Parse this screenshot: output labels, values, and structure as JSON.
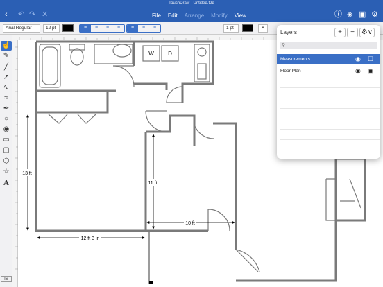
{
  "window": {
    "title": "TouchDraw - Untitled.t2d"
  },
  "menu": {
    "file": "File",
    "edit": "Edit",
    "arrange": "Arrange",
    "modify": "Modify",
    "view": "View"
  },
  "titlebar_icons": {
    "back": "chevron-left-icon",
    "undo": "undo-icon",
    "redo": "redo-icon",
    "close": "close-icon",
    "info": "info-icon",
    "layers": "layers-icon",
    "inspector": "inspector-icon",
    "settings": "gear-icon"
  },
  "format": {
    "font_name": "Arial Regular",
    "font_size": "12 pt",
    "line_width": "1 pt",
    "fill_color": "#000000",
    "stroke_color": "#000000"
  },
  "tools": [
    "pointer",
    "pencil",
    "line",
    "line-alt",
    "freehand",
    "curve",
    "pen",
    "circle",
    "target",
    "rectangle",
    "rounded-rectangle",
    "polygon",
    "star",
    "text"
  ],
  "status_badge": "IS",
  "layers_panel": {
    "title": "Layers",
    "add_label": "+",
    "remove_label": "−",
    "search_placeholder": "",
    "layers": [
      {
        "name": "Measurements",
        "selected": true,
        "visible": true,
        "locked": false
      },
      {
        "name": "Floor Plan",
        "selected": false,
        "visible": true,
        "locked": true
      }
    ]
  },
  "drawing": {
    "dimensions": {
      "left_height": "13 ft",
      "left_width": "12 ft 3 in",
      "right_height": "11 ft",
      "right_width": "10 ft"
    },
    "appliance_labels": {
      "washer": "W",
      "dryer": "D"
    }
  },
  "colors": {
    "accent": "#2b5fb4",
    "selection": "#3a6fc6",
    "wall": "#7a7a7a"
  }
}
